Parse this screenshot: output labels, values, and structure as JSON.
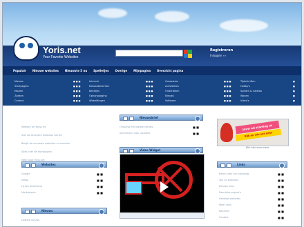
{
  "site": {
    "name": "Yoris.net",
    "tagline": "Your Favorite Websites",
    "search_placeholder": "",
    "login_title": "Registreren",
    "login_subtitle": "Inloggen ›››"
  },
  "nav": [
    "Populair",
    "Nieuwe websites",
    "Nieuwste 5 nu",
    "Spelletjes",
    "Overige",
    "Mijnpagina",
    "Overzicht pagina"
  ],
  "menus": [
    [
      "Nieuws",
      "Startpagina",
      "Muziek",
      "Zoeken",
      "Contact"
    ],
    [
      "Internet",
      "Nieuwsberichten",
      "Beeldjes",
      "Ophangpagina",
      "Afbeeldingen"
    ],
    [
      "Computers",
      "Activiteiten",
      "Onderdelen",
      "Nieuws",
      "Software"
    ],
    [
      "Tijdschriften",
      "Hobby's",
      "Spellen & Cadeau",
      "Wonen",
      "Video's"
    ]
  ],
  "left_panel_lines": [
    "Welkom bij Yoris.net",
    "Stel uw favoriete websites samen",
    "Bekijk de nieuwste websites en reacties",
    "Alles over de startpagina",
    "Meer over Yoris.net"
  ],
  "widgets": {
    "top_left": {
      "title": "Websites",
      "items": [
        "Google",
        "Yahoo",
        "Hyves Nederland",
        "Marktplaats"
      ]
    },
    "middle": {
      "title": "Nieuwsbrief",
      "items": [
        "Ontvang het laatste nieuws",
        "Aanmelden voor updates"
      ]
    },
    "video": {
      "title": "Video Widget"
    },
    "right": {
      "title": "Links",
      "items": [
        "Beste sites van vandaag",
        "Top 10 websites",
        "Nieuwe links",
        "Populaire pagina's",
        "Handige websites",
        "Meer links",
        "Reacties",
        "Contact"
      ]
    },
    "bottom_left": {
      "title": "Nieuws",
      "items": [
        "Laatste nieuws"
      ]
    }
  },
  "banner": {
    "title": "Jouw ad starting at Jandiverit!",
    "subtitle": "Klik en win een prijs",
    "link": "Klik hier voor meer"
  },
  "colors": {
    "accent": "#184583",
    "header": "#244f97",
    "widget": "#6f9ccc"
  }
}
